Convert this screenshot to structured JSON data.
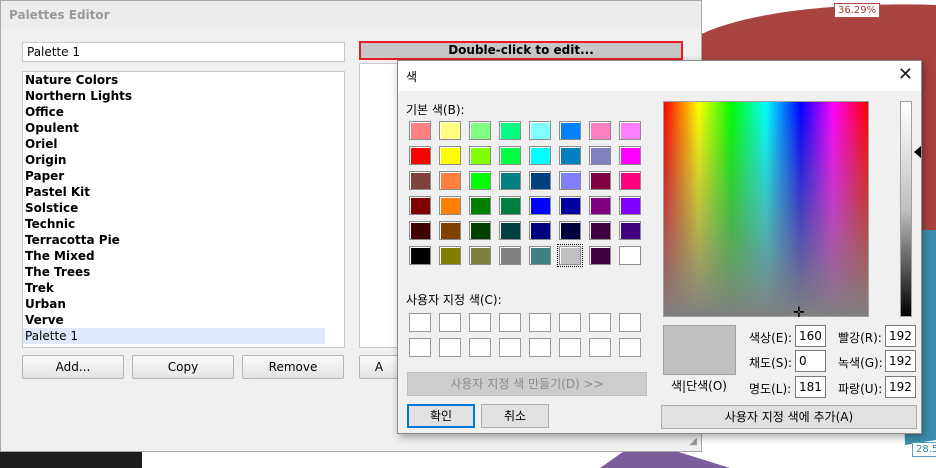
{
  "background_chart": {
    "labels": [
      "36.29%",
      "28.5"
    ],
    "colors": {
      "pie_red": "#a8433f",
      "pie_teal": "#3e8fae",
      "pie_purple": "#7a5e9a",
      "pie_dark": "#555555"
    }
  },
  "palettes_editor": {
    "title": "Palettes Editor",
    "name_value": "Palette 1",
    "palettes": [
      "Nature Colors",
      "Northern Lights",
      "Office",
      "Opulent",
      "Oriel",
      "Origin",
      "Paper",
      "Pastel Kit",
      "Solstice",
      "Technic",
      "Terracotta Pie",
      "The Mixed",
      "The Trees",
      "Trek",
      "Urban",
      "Verve",
      "Palette 1"
    ],
    "selected_palette": "Palette 1",
    "edit_hint": "Double-click to edit...",
    "buttons": {
      "add": "Add...",
      "copy": "Copy",
      "remove": "Remove",
      "apply_partial": "A"
    }
  },
  "color_dialog": {
    "title": "색",
    "basic_colors_label": "기본 색(B):",
    "custom_colors_label": "사용자 지정 색(C):",
    "define_custom": "사용자 지정 색 만들기(D) >>",
    "ok": "확인",
    "cancel": "취소",
    "solid_label": "색|단색(O)",
    "add_to_custom": "사용자 지정 색에 추가(A)",
    "hue_label": "색상(E):",
    "hue": "160",
    "sat_label": "채도(S):",
    "sat": "0",
    "lum_label": "명도(L):",
    "lum": "181",
    "red_label": "빨강(R):",
    "red": "192",
    "green_label": "녹색(G):",
    "green": "192",
    "blue_label": "파랑(U):",
    "blue": "192",
    "current_color": "#c0c0c0",
    "basic_colors": [
      [
        "#ff8080",
        "#ffff80",
        "#80ff80",
        "#00ff80",
        "#80ffff",
        "#0080ff",
        "#ff80c0",
        "#ff80ff"
      ],
      [
        "#ff0000",
        "#ffff00",
        "#80ff00",
        "#00ff40",
        "#00ffff",
        "#0080c0",
        "#8080c0",
        "#ff00ff"
      ],
      [
        "#804040",
        "#ff8040",
        "#00ff00",
        "#008080",
        "#004080",
        "#8080ff",
        "#800040",
        "#ff0080"
      ],
      [
        "#800000",
        "#ff8000",
        "#008000",
        "#008040",
        "#0000ff",
        "#0000a0",
        "#800080",
        "#8000ff"
      ],
      [
        "#400000",
        "#804000",
        "#004000",
        "#004040",
        "#000080",
        "#000040",
        "#400040",
        "#400080"
      ],
      [
        "#000000",
        "#808000",
        "#808040",
        "#808080",
        "#408080",
        "#c0c0c0",
        "#400040",
        "#ffffff"
      ]
    ],
    "selected_basic": "#c0c0c0"
  }
}
